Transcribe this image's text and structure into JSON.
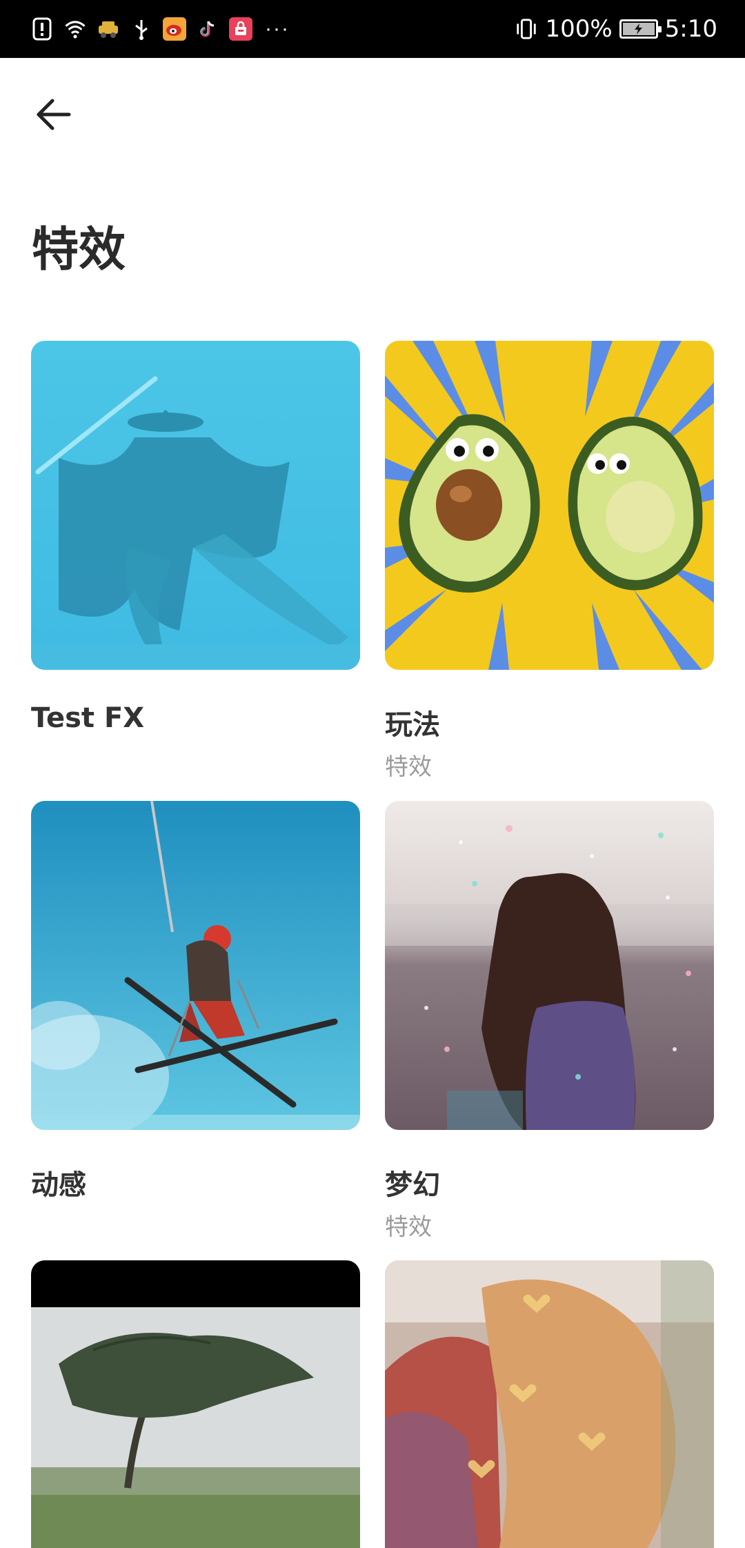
{
  "status_bar": {
    "battery_percent": "100%",
    "time": "5:10",
    "more_indicator": "···",
    "left_icons": [
      "alert-icon",
      "wifi-icon",
      "car-icon",
      "usb-icon",
      "weibo-icon",
      "tiktok-icon",
      "shop-icon"
    ],
    "right_icons": [
      "vibrate-icon",
      "battery-icon"
    ]
  },
  "header": {
    "back_icon": "back-arrow-icon",
    "title": "特效"
  },
  "effects": [
    {
      "title": "Test FX",
      "subtitle": ""
    },
    {
      "title": "玩法",
      "subtitle": "特效"
    },
    {
      "title": "动感",
      "subtitle": ""
    },
    {
      "title": "梦幻",
      "subtitle": "特效"
    },
    {
      "title": "",
      "subtitle": ""
    },
    {
      "title": "",
      "subtitle": ""
    }
  ],
  "colors": {
    "status_bar_bg": "#000000",
    "page_bg": "#ffffff",
    "title_text": "#2a2a2a",
    "subtitle_text": "#9b9b9b"
  }
}
